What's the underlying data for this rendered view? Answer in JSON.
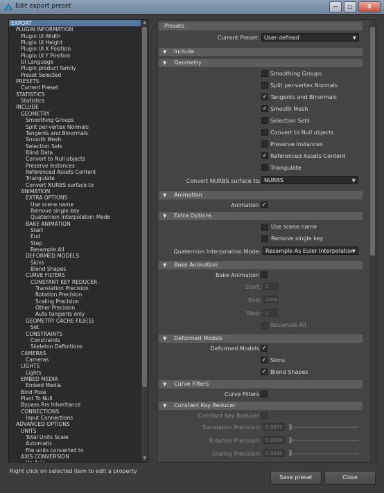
{
  "window": {
    "title": "Edit export preset",
    "minimize": "—",
    "restore": "□",
    "close": "X"
  },
  "tree": [
    {
      "label": "EXPORT",
      "level": 0,
      "selected": true
    },
    {
      "label": "PLUGIN INFORMATION",
      "level": 1
    },
    {
      "label": "Plugin UI Width",
      "level": 2
    },
    {
      "label": "Plugin UI Height",
      "level": 2
    },
    {
      "label": "Plugin UI X Position",
      "level": 2
    },
    {
      "label": "Plugin UI Y Position",
      "level": 2
    },
    {
      "label": "UI Language",
      "level": 2
    },
    {
      "label": "Plugin product family",
      "level": 2
    },
    {
      "label": "Preset Selected",
      "level": 2
    },
    {
      "label": "PRESETS",
      "level": 1
    },
    {
      "label": "Current Preset",
      "level": 2
    },
    {
      "label": "STATISTICS",
      "level": 1
    },
    {
      "label": "Statistics",
      "level": 2
    },
    {
      "label": "INCLUDE",
      "level": 1
    },
    {
      "label": "GEOMETRY",
      "level": 2
    },
    {
      "label": "Smoothing Groups",
      "level": 3
    },
    {
      "label": "Split per-vertex Normals",
      "level": 3
    },
    {
      "label": "Tangents and Binormals",
      "level": 3
    },
    {
      "label": "Smooth Mesh",
      "level": 3
    },
    {
      "label": "Selection Sets",
      "level": 3
    },
    {
      "label": "Blind Data",
      "level": 3
    },
    {
      "label": "Convert to Null objects",
      "level": 3
    },
    {
      "label": "Preserve Instances",
      "level": 3
    },
    {
      "label": "Referenced Assets Content",
      "level": 3
    },
    {
      "label": "Triangulate",
      "level": 3
    },
    {
      "label": "Convert NURBS surface to",
      "level": 3
    },
    {
      "label": "ANIMATION",
      "level": 2
    },
    {
      "label": "EXTRA OPTIONS",
      "level": 3
    },
    {
      "label": "Use scene name",
      "level": 4
    },
    {
      "label": "Remove single key",
      "level": 4
    },
    {
      "label": "Quaternion Interpolation Mode",
      "level": 4
    },
    {
      "label": "BAKE ANIMATION",
      "level": 3
    },
    {
      "label": "Start",
      "level": 4
    },
    {
      "label": "End",
      "level": 4
    },
    {
      "label": "Step",
      "level": 4
    },
    {
      "label": "Resample All",
      "level": 4
    },
    {
      "label": "DEFORMED MODELS",
      "level": 3
    },
    {
      "label": "Skins",
      "level": 4
    },
    {
      "label": "Blend Shapes",
      "level": 4
    },
    {
      "label": "CURVE FILTERS",
      "level": 3
    },
    {
      "label": "CONSTANT KEY REDUCER",
      "level": 4
    },
    {
      "label": "Translation Precision",
      "level": 5
    },
    {
      "label": "Rotation Precision",
      "level": 5
    },
    {
      "label": "Scaling Precision",
      "level": 5
    },
    {
      "label": "Other Precision",
      "level": 5
    },
    {
      "label": "Auto tangents only",
      "level": 5
    },
    {
      "label": "GEOMETRY CACHE FILE(S)",
      "level": 3
    },
    {
      "label": "Set",
      "level": 4
    },
    {
      "label": "CONSTRAINTS",
      "level": 3
    },
    {
      "label": "Constraints",
      "level": 4
    },
    {
      "label": "Skeleton Definitions",
      "level": 4
    },
    {
      "label": "CAMERAS",
      "level": 2
    },
    {
      "label": "Cameras",
      "level": 3
    },
    {
      "label": "LIGHTS",
      "level": 2
    },
    {
      "label": "Lights",
      "level": 3
    },
    {
      "label": "EMBED MEDIA",
      "level": 2
    },
    {
      "label": "Embed Media",
      "level": 3
    },
    {
      "label": "Bind Pose",
      "level": 2
    },
    {
      "label": "Pivot To Null",
      "level": 2
    },
    {
      "label": "Bypass Rrs Inheritance",
      "level": 2
    },
    {
      "label": "CONNECTIONS",
      "level": 2
    },
    {
      "label": "Input Connections",
      "level": 3
    },
    {
      "label": "ADVANCED OPTIONS",
      "level": 1
    },
    {
      "label": "UNITS",
      "level": 2
    },
    {
      "label": "Total Units Scale",
      "level": 3
    },
    {
      "label": "Automatic",
      "level": 3
    },
    {
      "label": "File units converted to",
      "level": 3
    },
    {
      "label": "AXIS CONVERSION",
      "level": 2
    },
    {
      "label": "Up Axis",
      "level": 3
    }
  ],
  "presets": {
    "header": "Presets",
    "current_label": "Current Preset:",
    "current_value": "User defined"
  },
  "include": {
    "header": "Include"
  },
  "geometry": {
    "header": "Geometry",
    "options": [
      {
        "label": "Smoothing Groups",
        "checked": false
      },
      {
        "label": "Split per-vertex Normals",
        "checked": false
      },
      {
        "label": "Tangents and Binormals",
        "checked": true
      },
      {
        "label": "Smooth Mesh",
        "checked": true
      },
      {
        "label": "Selection Sets",
        "checked": false
      },
      {
        "label": "Convert to Null objects",
        "checked": false
      },
      {
        "label": "Preserve Instances",
        "checked": false
      },
      {
        "label": "Referenced Assets Content",
        "checked": true
      },
      {
        "label": "Triangulate",
        "checked": false
      }
    ],
    "nurbs_label": "Convert NURBS surface to:",
    "nurbs_value": "NURBS"
  },
  "animation": {
    "header": "Animation",
    "label": "Animation",
    "checked": true
  },
  "extra_options": {
    "header": "Extra Options",
    "use_scene_name": "Use scene name",
    "remove_single_key": "Remove single key",
    "quat_label": "Quaternion Interpolation Mode:",
    "quat_value": "Resample As Euler Interpolation"
  },
  "bake_animation": {
    "header": "Bake Animation",
    "label": "Bake Animation",
    "start_label": "Start:",
    "start_value": "1",
    "end_label": "End:",
    "end_value": "2000",
    "step_label": "Step:",
    "step_value": "1",
    "resample_label": "Resample All"
  },
  "deformed_models": {
    "header": "Deformed Models",
    "label": "Deformed Models",
    "skins": "Skins",
    "blend_shapes": "Blend Shapes"
  },
  "curve_filters": {
    "header": "Curve Filters",
    "label": "Curve Filters"
  },
  "constant_key_reducer": {
    "header": "Constant Key Reducer",
    "label": "Constant Key Reducer",
    "translation_label": "Translation Precision:",
    "translation_value": "0.0001",
    "rotation_label": "Rotation Precision:",
    "rotation_value": "0.0090",
    "scaling_label": "Scaling Precision:",
    "scaling_value": "0.0040"
  },
  "status_text": "Right click on selected item to edit a property",
  "buttons": {
    "save": "Save preset",
    "close": "Close"
  },
  "icons": {
    "collapse": "▼",
    "dropdown": "▼",
    "check": "✓",
    "scroll_up": "▲",
    "scroll_down": "▼"
  }
}
